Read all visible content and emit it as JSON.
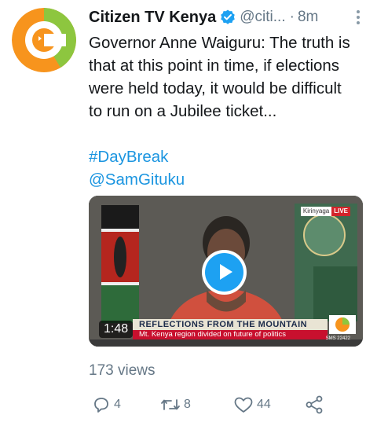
{
  "tweet": {
    "author_name": "Citizen TV Kenya",
    "handle": "@citi...",
    "separator": "·",
    "time": "8m",
    "text_lines": [
      "Governor Anne Waiguru: The truth is",
      "that at this point in time, if elections",
      "were held today, it would be difficult",
      "to run on a Jubilee ticket..."
    ],
    "hashtag": "#DayBreak",
    "mention": "@SamGituku"
  },
  "video": {
    "duration": "1:48",
    "banner_title": "REFLECTIONS FROM THE MOUNTAIN",
    "banner_subtitle": "Mt. Kenya region divided on future of politics",
    "location": "Kirinyaga",
    "live_label": "LIVE",
    "sms_text": "SMS 22422"
  },
  "views": "173 views",
  "actions": {
    "reply_count": "4",
    "retweet_count": "8",
    "like_count": "44"
  },
  "colors": {
    "brand_orange": "#f7941d",
    "brand_green": "#8dc63f",
    "link": "#1b95e0",
    "play": "#1da1f2",
    "secondary_text": "#657786",
    "verified": "#1da1f2"
  },
  "icons": [
    "citizen-tv-logo",
    "verified-badge-icon",
    "more-options-icon",
    "play-icon",
    "reply-icon",
    "retweet-icon",
    "like-icon",
    "share-icon"
  ]
}
